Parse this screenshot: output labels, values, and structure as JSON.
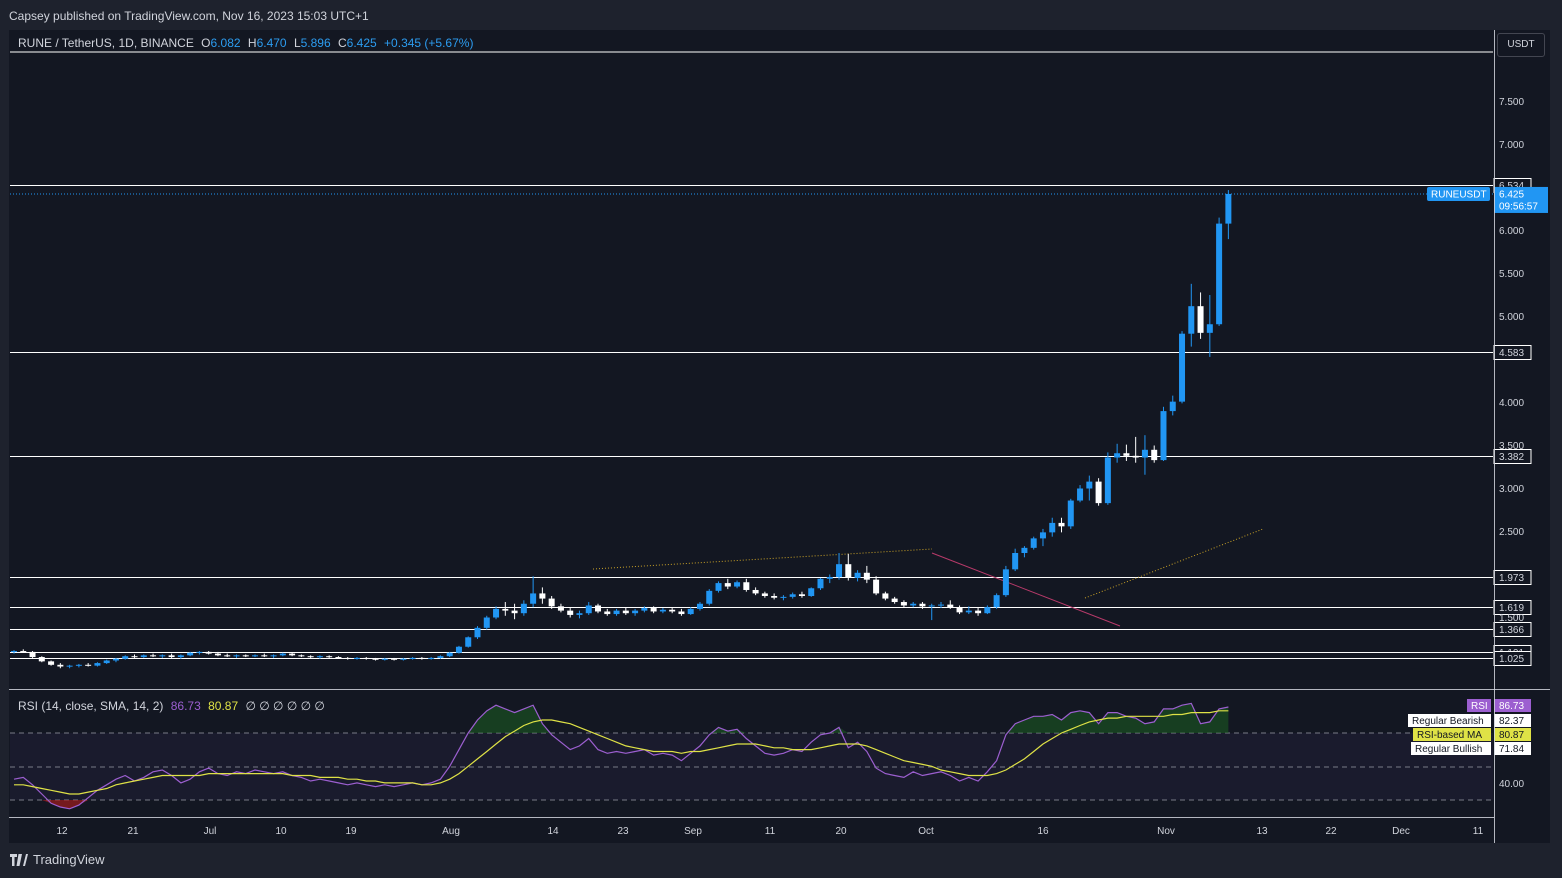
{
  "header": {
    "publisher": "Capsey published on TradingView.com, Nov 16, 2023 15:03 UTC+1"
  },
  "legend": {
    "symbol": "RUNE / TetherUS, 1D, BINANCE",
    "o_label": "O",
    "o_val": "6.082",
    "h_label": "H",
    "h_val": "6.470",
    "l_label": "L",
    "l_val": "5.896",
    "c_label": "C",
    "c_val": "6.425",
    "change": "+0.345 (+5.67%)"
  },
  "currency_button": "USDT",
  "rsi_legend": {
    "title": "RSI (14, close, SMA, 14, 2)",
    "rsi": "86.73",
    "ma": "80.87",
    "extras": "∅ ∅ ∅ ∅ ∅ ∅"
  },
  "footer": {
    "brand": "TradingView"
  },
  "colors": {
    "up": "#2196f3",
    "down": "#ffffff",
    "bg": "#131722",
    "rsi": "#9c5fd0",
    "rsi_ma": "#dfe246",
    "accent": "#2962ff"
  },
  "chart_data": [
    {
      "type": "candlestick",
      "symbol": "RUNEUSDT",
      "price_axis_ticks": [
        "7.500",
        "7.000",
        "6.000",
        "5.500",
        "5.000",
        "4.000",
        "3.500",
        "3.000",
        "2.500",
        "1.500"
      ],
      "date_axis_ticks": [
        "12",
        "21",
        "Jul",
        "10",
        "19",
        "Aug",
        "14",
        "23",
        "Sep",
        "11",
        "20",
        "Oct",
        "16",
        "Nov",
        "13",
        "22",
        "Dec",
        "11"
      ],
      "horizontal_levels": [
        "6.534",
        "4.583",
        "3.382",
        "1.973",
        "1.619",
        "1.366",
        "1.101",
        "1.025"
      ],
      "last_price": {
        "label": "RUNEUSDT",
        "value": "6.425",
        "countdown": "09:56:57"
      },
      "ylim": [
        0.9,
        8.0
      ],
      "ohlc": [
        [
          1.1,
          1.12,
          1.08,
          1.11
        ],
        [
          1.11,
          1.13,
          1.09,
          1.1
        ],
        [
          1.1,
          1.11,
          1.03,
          1.04
        ],
        [
          1.04,
          1.05,
          0.98,
          0.99
        ],
        [
          0.99,
          1.0,
          0.94,
          0.95
        ],
        [
          0.95,
          0.97,
          0.91,
          0.93
        ],
        [
          0.93,
          0.95,
          0.91,
          0.94
        ],
        [
          0.94,
          0.96,
          0.92,
          0.95
        ],
        [
          0.95,
          0.97,
          0.93,
          0.94
        ],
        [
          0.94,
          0.98,
          0.93,
          0.97
        ],
        [
          0.97,
          1.01,
          0.96,
          1.0
        ],
        [
          1.0,
          1.03,
          0.98,
          1.02
        ],
        [
          1.02,
          1.06,
          1.01,
          1.05
        ],
        [
          1.05,
          1.07,
          1.03,
          1.04
        ],
        [
          1.04,
          1.07,
          1.03,
          1.06
        ],
        [
          1.06,
          1.08,
          1.04,
          1.05
        ],
        [
          1.05,
          1.07,
          1.03,
          1.06
        ],
        [
          1.06,
          1.08,
          1.03,
          1.04
        ],
        [
          1.04,
          1.07,
          1.02,
          1.06
        ],
        [
          1.06,
          1.1,
          1.05,
          1.09
        ],
        [
          1.09,
          1.11,
          1.07,
          1.1
        ],
        [
          1.1,
          1.11,
          1.07,
          1.08
        ],
        [
          1.08,
          1.1,
          1.05,
          1.06
        ],
        [
          1.06,
          1.08,
          1.04,
          1.05
        ],
        [
          1.05,
          1.07,
          1.03,
          1.06
        ],
        [
          1.06,
          1.07,
          1.04,
          1.05
        ],
        [
          1.05,
          1.07,
          1.04,
          1.06
        ],
        [
          1.06,
          1.08,
          1.04,
          1.05
        ],
        [
          1.05,
          1.07,
          1.03,
          1.06
        ],
        [
          1.06,
          1.09,
          1.05,
          1.08
        ],
        [
          1.08,
          1.09,
          1.05,
          1.06
        ],
        [
          1.06,
          1.07,
          1.04,
          1.05
        ],
        [
          1.05,
          1.06,
          1.03,
          1.04
        ],
        [
          1.04,
          1.06,
          1.02,
          1.05
        ],
        [
          1.05,
          1.06,
          1.03,
          1.04
        ],
        [
          1.04,
          1.05,
          1.02,
          1.03
        ],
        [
          1.03,
          1.04,
          1.01,
          1.02
        ],
        [
          1.02,
          1.04,
          1.01,
          1.03
        ],
        [
          1.03,
          1.04,
          1.01,
          1.02
        ],
        [
          1.02,
          1.03,
          1.0,
          1.01
        ],
        [
          1.01,
          1.03,
          1.0,
          1.02
        ],
        [
          1.02,
          1.03,
          1.0,
          1.01
        ],
        [
          1.01,
          1.03,
          1.0,
          1.02
        ],
        [
          1.02,
          1.04,
          1.01,
          1.03
        ],
        [
          1.03,
          1.04,
          1.01,
          1.02
        ],
        [
          1.02,
          1.04,
          1.01,
          1.03
        ],
        [
          1.03,
          1.06,
          1.02,
          1.05
        ],
        [
          1.05,
          1.1,
          1.04,
          1.09
        ],
        [
          1.09,
          1.17,
          1.08,
          1.16
        ],
        [
          1.16,
          1.28,
          1.15,
          1.27
        ],
        [
          1.27,
          1.4,
          1.25,
          1.38
        ],
        [
          1.38,
          1.52,
          1.36,
          1.5
        ],
        [
          1.5,
          1.63,
          1.48,
          1.6
        ],
        [
          1.6,
          1.68,
          1.52,
          1.58
        ],
        [
          1.58,
          1.66,
          1.48,
          1.55
        ],
        [
          1.55,
          1.7,
          1.52,
          1.66
        ],
        [
          1.66,
          1.98,
          1.62,
          1.78
        ],
        [
          1.78,
          1.85,
          1.66,
          1.72
        ],
        [
          1.72,
          1.75,
          1.6,
          1.63
        ],
        [
          1.63,
          1.66,
          1.56,
          1.58
        ],
        [
          1.58,
          1.61,
          1.5,
          1.53
        ],
        [
          1.53,
          1.58,
          1.49,
          1.55
        ],
        [
          1.55,
          1.68,
          1.53,
          1.64
        ],
        [
          1.64,
          1.66,
          1.55,
          1.57
        ],
        [
          1.57,
          1.6,
          1.52,
          1.54
        ],
        [
          1.54,
          1.6,
          1.52,
          1.58
        ],
        [
          1.58,
          1.62,
          1.53,
          1.55
        ],
        [
          1.55,
          1.6,
          1.52,
          1.58
        ],
        [
          1.58,
          1.63,
          1.56,
          1.61
        ],
        [
          1.61,
          1.63,
          1.55,
          1.57
        ],
        [
          1.57,
          1.61,
          1.55,
          1.59
        ],
        [
          1.59,
          1.61,
          1.55,
          1.57
        ],
        [
          1.57,
          1.6,
          1.52,
          1.54
        ],
        [
          1.54,
          1.62,
          1.53,
          1.6
        ],
        [
          1.6,
          1.68,
          1.58,
          1.66
        ],
        [
          1.66,
          1.83,
          1.64,
          1.81
        ],
        [
          1.81,
          1.92,
          1.79,
          1.9
        ],
        [
          1.9,
          1.95,
          1.83,
          1.86
        ],
        [
          1.86,
          1.93,
          1.84,
          1.91
        ],
        [
          1.91,
          1.95,
          1.8,
          1.82
        ],
        [
          1.82,
          1.85,
          1.76,
          1.78
        ],
        [
          1.78,
          1.8,
          1.73,
          1.75
        ],
        [
          1.75,
          1.78,
          1.71,
          1.73
        ],
        [
          1.73,
          1.76,
          1.7,
          1.74
        ],
        [
          1.74,
          1.79,
          1.72,
          1.77
        ],
        [
          1.77,
          1.8,
          1.73,
          1.75
        ],
        [
          1.75,
          1.85,
          1.74,
          1.84
        ],
        [
          1.84,
          1.96,
          1.82,
          1.95
        ],
        [
          1.95,
          2.0,
          1.9,
          1.97
        ],
        [
          1.97,
          2.25,
          1.94,
          2.12
        ],
        [
          2.12,
          2.24,
          1.93,
          1.96
        ],
        [
          1.96,
          2.05,
          1.92,
          2.02
        ],
        [
          2.02,
          2.1,
          1.9,
          1.94
        ],
        [
          1.94,
          1.98,
          1.76,
          1.78
        ],
        [
          1.78,
          1.8,
          1.7,
          1.72
        ],
        [
          1.72,
          1.74,
          1.66,
          1.68
        ],
        [
          1.68,
          1.7,
          1.62,
          1.64
        ],
        [
          1.64,
          1.68,
          1.62,
          1.66
        ],
        [
          1.66,
          1.68,
          1.6,
          1.63
        ],
        [
          1.63,
          1.66,
          1.47,
          1.64
        ],
        [
          1.64,
          1.68,
          1.61,
          1.65
        ],
        [
          1.65,
          1.7,
          1.6,
          1.62
        ],
        [
          1.62,
          1.64,
          1.54,
          1.56
        ],
        [
          1.56,
          1.63,
          1.54,
          1.58
        ],
        [
          1.58,
          1.62,
          1.52,
          1.55
        ],
        [
          1.55,
          1.64,
          1.54,
          1.62
        ],
        [
          1.62,
          1.78,
          1.6,
          1.76
        ],
        [
          1.76,
          2.1,
          1.74,
          2.06
        ],
        [
          2.06,
          2.3,
          2.04,
          2.25
        ],
        [
          2.25,
          2.33,
          2.2,
          2.31
        ],
        [
          2.31,
          2.44,
          2.29,
          2.42
        ],
        [
          2.42,
          2.53,
          2.33,
          2.49
        ],
        [
          2.49,
          2.66,
          2.44,
          2.6
        ],
        [
          2.6,
          2.66,
          2.49,
          2.56
        ],
        [
          2.56,
          2.88,
          2.53,
          2.86
        ],
        [
          2.86,
          3.04,
          2.84,
          3.0
        ],
        [
          3.0,
          3.15,
          2.86,
          3.08
        ],
        [
          3.08,
          3.12,
          2.8,
          2.83
        ],
        [
          2.83,
          3.42,
          2.81,
          3.36
        ],
        [
          3.36,
          3.52,
          3.3,
          3.41
        ],
        [
          3.41,
          3.51,
          3.32,
          3.38
        ],
        [
          3.38,
          3.6,
          3.3,
          3.36
        ],
        [
          3.36,
          3.62,
          3.16,
          3.45
        ],
        [
          3.45,
          3.5,
          3.3,
          3.33
        ],
        [
          3.33,
          3.95,
          3.32,
          3.9
        ],
        [
          3.9,
          4.08,
          3.85,
          4.01
        ],
        [
          4.01,
          4.83,
          3.99,
          4.8
        ],
        [
          4.8,
          5.38,
          4.65,
          5.12
        ],
        [
          5.12,
          5.28,
          4.74,
          4.81
        ],
        [
          4.81,
          5.25,
          4.53,
          4.91
        ],
        [
          4.91,
          6.15,
          4.89,
          6.08
        ],
        [
          6.08,
          6.47,
          5.9,
          6.425
        ]
      ],
      "annotations": [
        {
          "type": "dotted-trendline",
          "color": "#c9a227"
        },
        {
          "type": "trendline",
          "color": "#b83a6a"
        },
        {
          "type": "dotted-trendline",
          "color": "#c9a227"
        }
      ]
    },
    {
      "type": "line",
      "title": "RSI (14, close, SMA, 14, 2)",
      "series": [
        {
          "name": "RSI",
          "color": "#9c5fd0",
          "values": [
            48,
            49,
            45,
            40,
            35,
            33,
            32,
            34,
            38,
            42,
            45,
            48,
            50,
            47,
            49,
            52,
            53,
            50,
            46,
            48,
            52,
            54,
            51,
            50,
            52,
            51,
            53,
            52,
            51,
            52,
            50,
            49,
            47,
            48,
            47,
            46,
            45,
            46,
            45,
            44,
            45,
            44,
            45,
            46,
            45,
            46,
            48,
            55,
            64,
            73,
            80,
            85,
            88,
            86,
            84,
            86,
            88,
            78,
            72,
            68,
            64,
            66,
            70,
            64,
            62,
            63,
            62,
            63,
            64,
            61,
            62,
            61,
            58,
            62,
            66,
            72,
            76,
            74,
            75,
            70,
            66,
            62,
            61,
            62,
            64,
            63,
            68,
            72,
            73,
            76,
            65,
            68,
            63,
            54,
            51,
            50,
            49,
            52,
            50,
            51,
            52,
            50,
            47,
            49,
            47,
            52,
            58,
            72,
            78,
            80,
            82,
            82,
            83,
            80,
            84,
            85,
            84,
            78,
            84,
            84,
            82,
            81,
            78,
            79,
            86,
            86,
            88,
            89,
            78,
            79,
            86,
            87
          ]
        },
        {
          "name": "RSI-based MA",
          "color": "#dfe246",
          "values": [
            45,
            45,
            44,
            43,
            42,
            41,
            40,
            40,
            41,
            42,
            43,
            45,
            46,
            47,
            48,
            49,
            50,
            50,
            50,
            50,
            50,
            51,
            51,
            51,
            51,
            51,
            51,
            51,
            51,
            51,
            50,
            50,
            50,
            49,
            49,
            49,
            48,
            48,
            47,
            47,
            46,
            46,
            46,
            46,
            45,
            45,
            46,
            48,
            51,
            55,
            59,
            63,
            67,
            71,
            74,
            77,
            79,
            80,
            80,
            79,
            78,
            76,
            74,
            72,
            70,
            68,
            66,
            65,
            64,
            63,
            63,
            63,
            62,
            63,
            63,
            64,
            65,
            66,
            67,
            67,
            67,
            66,
            65,
            65,
            64,
            64,
            64,
            65,
            66,
            67,
            67,
            67,
            66,
            64,
            62,
            60,
            58,
            57,
            56,
            55,
            53,
            52,
            51,
            50,
            50,
            50,
            51,
            53,
            56,
            59,
            63,
            67,
            70,
            73,
            75,
            77,
            79,
            80,
            81,
            81,
            82,
            82,
            82,
            82,
            82,
            83,
            83,
            84,
            84,
            84,
            85,
            85
          ]
        }
      ],
      "guide_levels": [
        "71.84",
        "40.00"
      ],
      "labels": [
        {
          "name": "RSI",
          "value": "86.73"
        },
        {
          "name": "Regular Bearish",
          "value": "82.37"
        },
        {
          "name": "RSI-based MA",
          "value": "80.87"
        },
        {
          "name": "Regular Bullish",
          "value": "71.84"
        }
      ],
      "y_tick": "40.00"
    }
  ]
}
